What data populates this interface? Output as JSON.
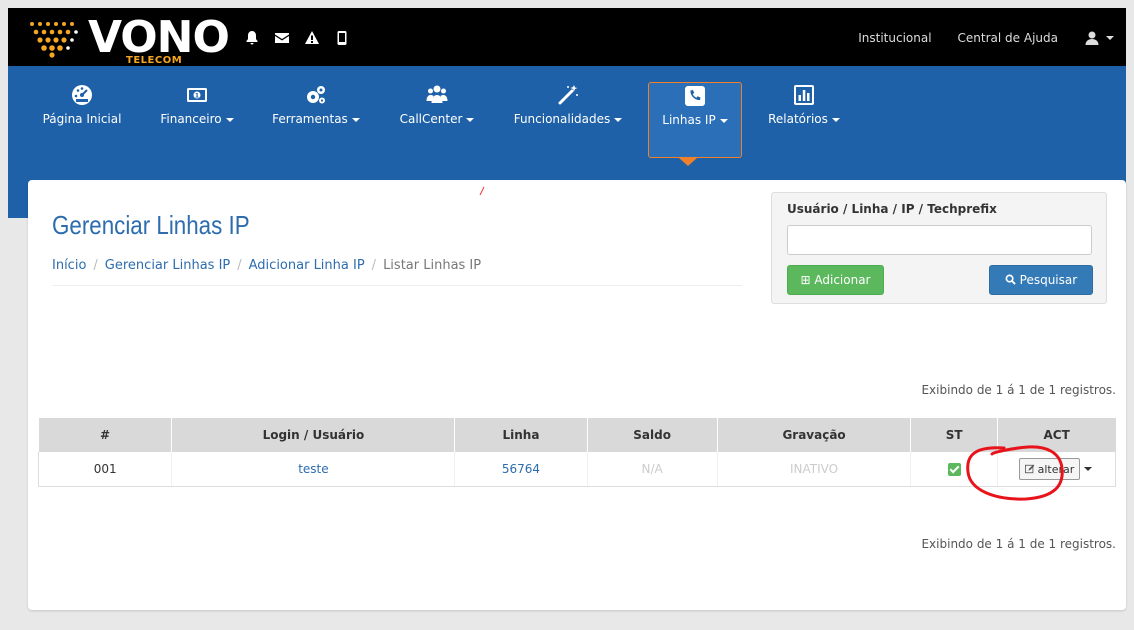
{
  "brand": {
    "name": "VONO",
    "sub": "TELECOM",
    "accent": "#f5a623"
  },
  "top_links": {
    "institutional": "Institucional",
    "help": "Central de Ajuda"
  },
  "top_icons": [
    "bell-icon",
    "envelope-icon",
    "warning-icon",
    "mobile-icon"
  ],
  "nav": {
    "home": "Página Inicial",
    "finance": "Financeiro",
    "tools": "Ferramentas",
    "callcenter": "CallCenter",
    "features": "Funcionalidades",
    "lines": "Linhas IP",
    "reports": "Relatórios"
  },
  "page": {
    "title": "Gerenciar Linhas IP",
    "breadcrumb": {
      "home": "Início",
      "manage": "Gerenciar Linhas IP",
      "add": "Adicionar Linha IP",
      "current": "Listar Linhas IP"
    }
  },
  "search": {
    "label": "Usuário / Linha / IP / Techprefix",
    "value": "",
    "add_button": "Adicionar",
    "search_button": "Pesquisar"
  },
  "records_text": "Exibindo de 1 á 1 de 1 registros.",
  "table": {
    "columns": [
      "#",
      "Login / Usuário",
      "Linha",
      "Saldo",
      "Gravação",
      "ST",
      "ACT"
    ],
    "rows": [
      {
        "id": "001",
        "login": "teste",
        "line": "56764",
        "balance": "N/A",
        "recording": "INATIVO",
        "status": "active",
        "action": "alterar"
      }
    ]
  },
  "colors": {
    "nav_blue": "#1e61a8",
    "active_border": "#f0802a",
    "title_blue": "#2d6cae"
  }
}
